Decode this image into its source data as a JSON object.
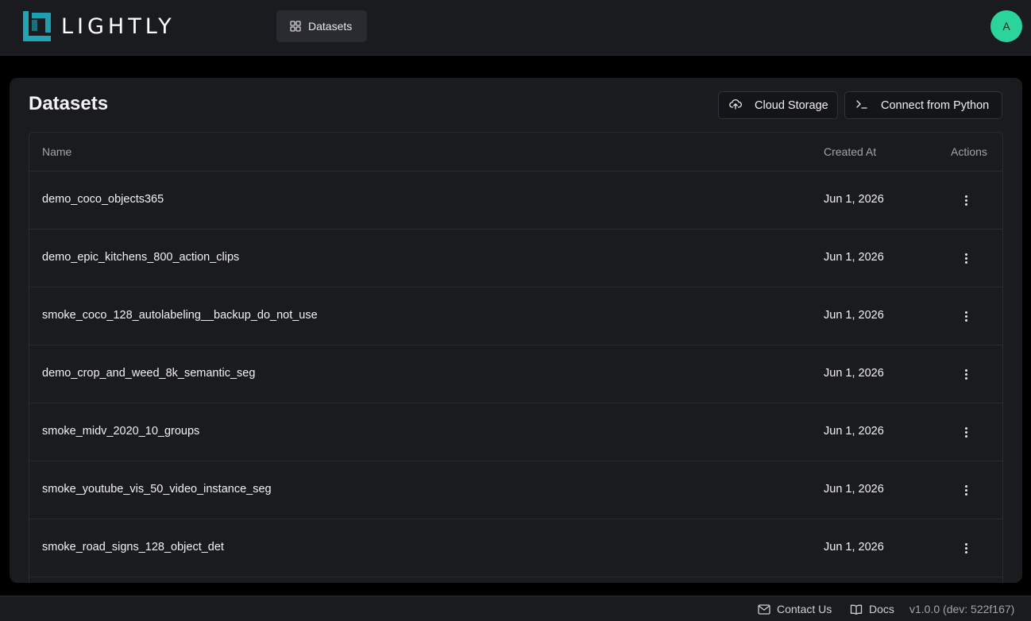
{
  "header": {
    "logo_text": "LIGHTLY",
    "nav_label": "Datasets",
    "avatar_initial": "A"
  },
  "main": {
    "title": "Datasets",
    "cloud_storage_label": "Cloud Storage",
    "connect_python_label": "Connect from Python",
    "columns": {
      "name": "Name",
      "created_at": "Created At",
      "actions": "Actions"
    },
    "rows": [
      {
        "name": "demo_coco_objects365",
        "created": "Jun 1, 2026"
      },
      {
        "name": "demo_epic_kitchens_800_action_clips",
        "created": "Jun 1, 2026"
      },
      {
        "name": "smoke_coco_128_autolabeling__backup_do_not_use",
        "created": "Jun 1, 2026"
      },
      {
        "name": "demo_crop_and_weed_8k_semantic_seg",
        "created": "Jun 1, 2026"
      },
      {
        "name": "smoke_midv_2020_10_groups",
        "created": "Jun 1, 2026"
      },
      {
        "name": "smoke_youtube_vis_50_video_instance_seg",
        "created": "Jun 1, 2026"
      },
      {
        "name": "smoke_road_signs_128_object_det",
        "created": "Jun 1, 2026"
      }
    ]
  },
  "footer": {
    "contact_label": "Contact Us",
    "docs_label": "Docs",
    "version": "v1.0.0 (dev: 522f167)"
  },
  "colors": {
    "accent": "#2bd49b",
    "logo_teal": "#1fa6b5",
    "background": "#000000",
    "surface": "#1a1b1f"
  }
}
